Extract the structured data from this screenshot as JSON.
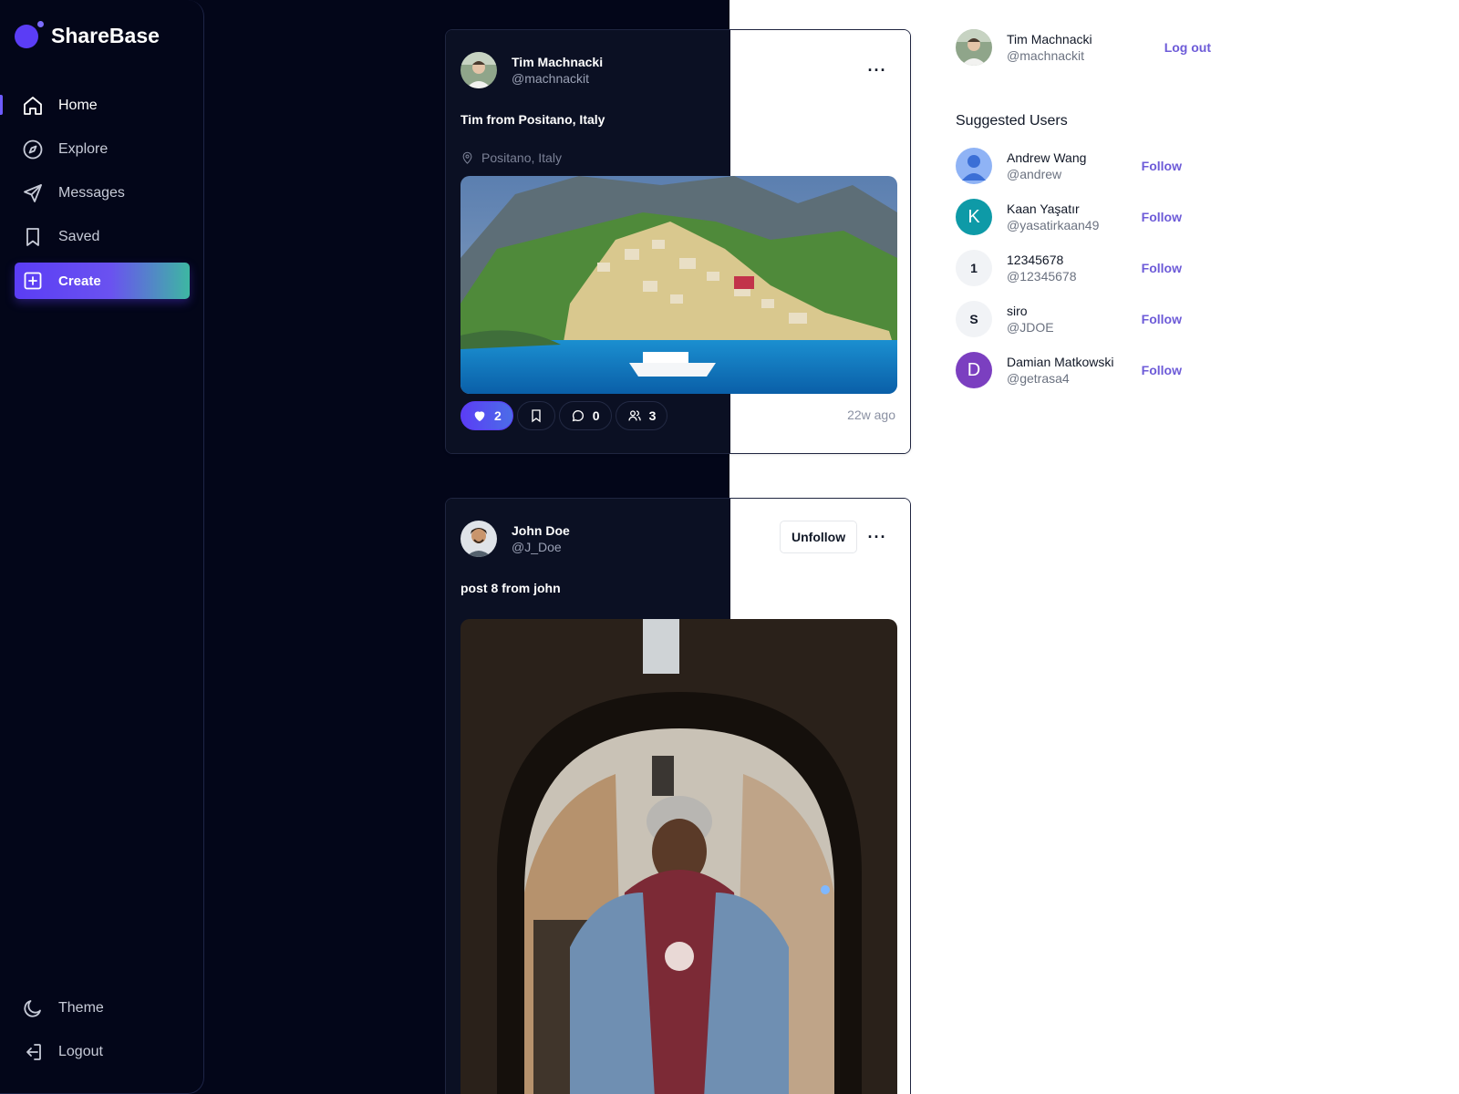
{
  "app": {
    "name": "ShareBase"
  },
  "nav": {
    "items": [
      {
        "label": "Home",
        "icon": "home-icon",
        "active": true
      },
      {
        "label": "Explore",
        "icon": "compass-icon"
      },
      {
        "label": "Messages",
        "icon": "send-icon"
      },
      {
        "label": "Saved",
        "icon": "bookmark-icon"
      }
    ],
    "create_label": "Create",
    "theme_label": "Theme",
    "logout_label": "Logout"
  },
  "posts": [
    {
      "author": {
        "name": "Tim Machnacki",
        "handle": "@machnackit"
      },
      "text": "Tim from Positano, Italy",
      "location": "Positano, Italy",
      "likes": "2",
      "comments": "0",
      "collaborators": "3",
      "time": "22w ago",
      "liked": true
    },
    {
      "author": {
        "name": "John Doe",
        "handle": "@J_Doe"
      },
      "text": "post 8 from john",
      "follow_button": "Unfollow"
    }
  ],
  "current_user": {
    "name": "Tim Machnacki",
    "handle": "@machnackit",
    "logout_label": "Log out"
  },
  "suggested": {
    "title": "Suggested Users",
    "follow_label": "Follow",
    "users": [
      {
        "name": "Andrew Wang",
        "handle": "@andrew",
        "avatar": "",
        "avatar_color": "#8fb3f5"
      },
      {
        "name": "Kaan Yaşatır",
        "handle": "@yasatirkaan49",
        "avatar": "K",
        "avatar_color": "#0e9aa7"
      },
      {
        "name": "12345678",
        "handle": "@12345678",
        "avatar": "1",
        "avatar_color": "#f1f3f6"
      },
      {
        "name": "siro",
        "handle": "@JDOE",
        "avatar": "S",
        "avatar_color": "#f1f3f6"
      },
      {
        "name": "Damian Matkowski",
        "handle": "@getrasa4",
        "avatar": "D",
        "avatar_color": "#7b3fc0"
      }
    ]
  },
  "colors": {
    "accent": "#5b3df5",
    "link": "#6d5bd8",
    "dark_bg": "#030619",
    "card_dark": "#0b1023"
  }
}
